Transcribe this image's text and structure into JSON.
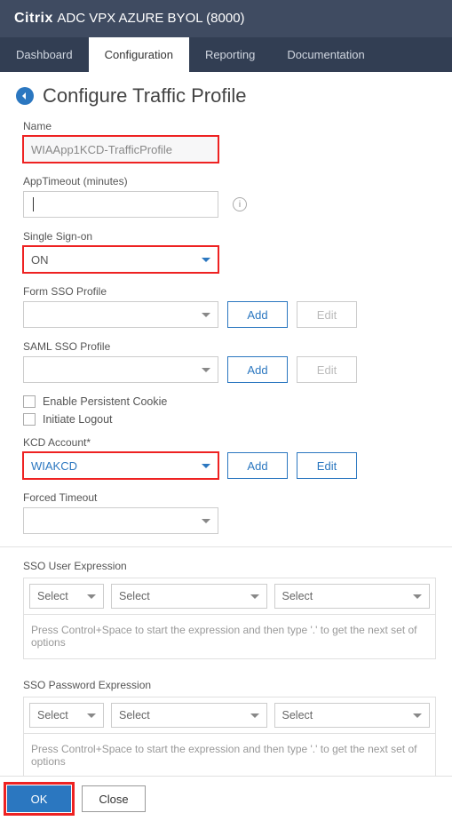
{
  "header": {
    "brand": "Citrix",
    "product": "ADC VPX AZURE BYOL (8000)"
  },
  "tabs": {
    "dashboard": "Dashboard",
    "configuration": "Configuration",
    "reporting": "Reporting",
    "documentation": "Documentation"
  },
  "page": {
    "title": "Configure Traffic Profile"
  },
  "labels": {
    "name": "Name",
    "appTimeout": "AppTimeout (minutes)",
    "sso": "Single Sign-on",
    "formSso": "Form SSO Profile",
    "samlSso": "SAML SSO Profile",
    "persistCookie": "Enable Persistent Cookie",
    "initLogout": "Initiate Logout",
    "kcd": "KCD Account*",
    "forced": "Forced Timeout",
    "ssoUser": "SSO User Expression",
    "ssoPass": "SSO Password Expression"
  },
  "values": {
    "name": "WIAApp1KCD-TrafficProfile",
    "sso": "ON",
    "kcd": "WIAKCD"
  },
  "buttons": {
    "add": "Add",
    "edit": "Edit",
    "ok": "OK",
    "close": "Close"
  },
  "expr": {
    "select": "Select",
    "hint": "Press Control+Space to start the expression and then type '.' to get the next set of options"
  }
}
